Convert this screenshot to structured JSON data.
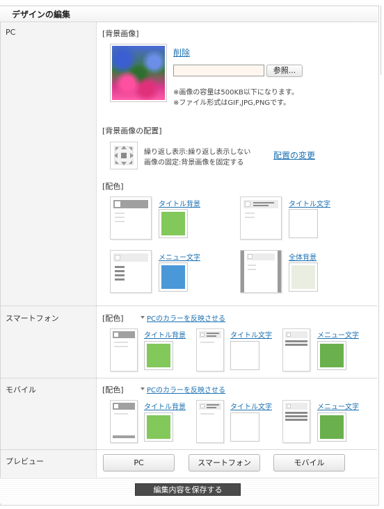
{
  "header": {
    "title": "デザインの編集"
  },
  "pc": {
    "label": "PC",
    "bg_image": {
      "section": "[背景画像]",
      "delete": "削除",
      "browse": "参照...",
      "note1": "※画像の容量は500KB以下になります。",
      "note2": "※ファイル形式はGIF,JPG,PNGです。"
    },
    "placement": {
      "section": "[背景画像の配置]",
      "line1": "繰り返し表示:繰り返し表示しない",
      "line2": "画像の固定:背景画像を固定する",
      "change": "配置の変更"
    },
    "colors": {
      "section": "[配色]",
      "items": [
        {
          "label": "タイトル背景",
          "color": "#82c85a"
        },
        {
          "label": "タイトル文字",
          "color": "#ffffff"
        },
        {
          "label": "メニュー文字",
          "color": "#4a98d8"
        },
        {
          "label": "全体背景",
          "color": "#e9eee0"
        }
      ]
    }
  },
  "smartphone": {
    "label": "スマートフォン",
    "section": "[配色]",
    "reflect": "PCのカラーを反映させる",
    "items": [
      {
        "label": "タイトル背景",
        "color": "#82c85a"
      },
      {
        "label": "タイトル文字",
        "color": "#ffffff"
      },
      {
        "label": "メニュー文字",
        "color": "#6ab04c"
      }
    ]
  },
  "mobile": {
    "label": "モバイル",
    "section": "[配色]",
    "reflect": "PCのカラーを反映させる",
    "items": [
      {
        "label": "タイトル背景",
        "color": "#82c85a"
      },
      {
        "label": "タイトル文字",
        "color": "#ffffff"
      },
      {
        "label": "メニュー文字",
        "color": "#6ab04c"
      }
    ]
  },
  "preview": {
    "label": "プレビュー",
    "buttons": [
      "PC",
      "スマートフォン",
      "モバイル"
    ]
  },
  "save": {
    "label": "編集内容を保存する"
  }
}
